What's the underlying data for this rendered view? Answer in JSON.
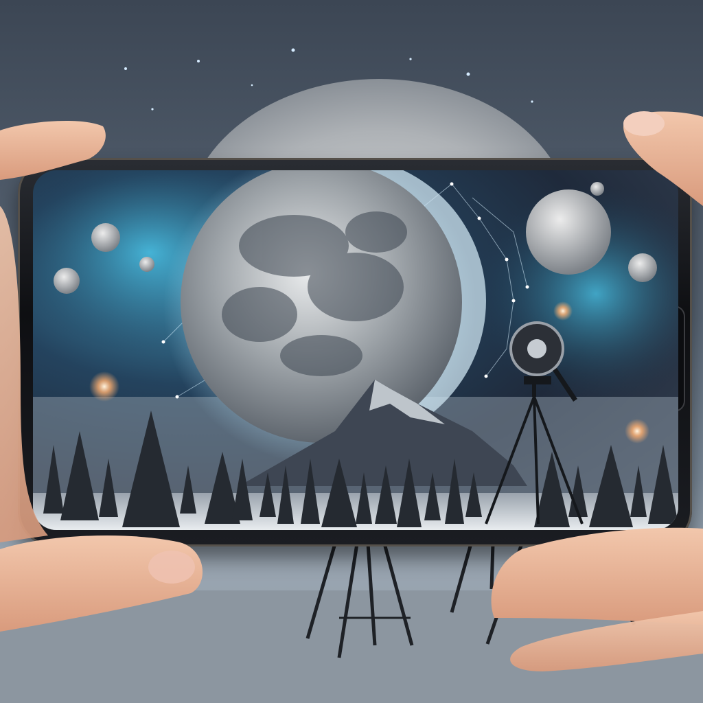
{
  "scene": {
    "description_tag": "",
    "colors": {
      "sky_top": "#3c4654",
      "sky_bottom": "#9aa6b2",
      "nebula": "#3f9fc0",
      "moon": "#c9ccce",
      "skin": "#e9b79a",
      "phone_frame": "#111216",
      "star_glow": "#ffb070"
    },
    "icons": [
      "moon-icon",
      "mountain-icon",
      "tripod-icon",
      "camera-icon",
      "tree-icon",
      "star-icon",
      "hand-icon"
    ]
  }
}
